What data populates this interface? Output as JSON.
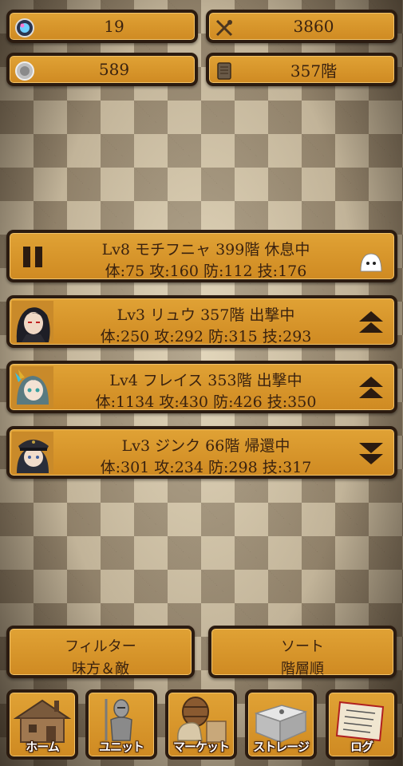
{
  "resources": {
    "gems": "19",
    "swords": "3860",
    "coins": "589",
    "floor": "357階"
  },
  "units": [
    {
      "line1": "Lv8 モチフニャ 399階 休息中",
      "line2": "体:75 攻:160 防:112 技:176",
      "left_icon": "pause-icon",
      "right_icon": "slime-icon"
    },
    {
      "line1": "Lv3 リュウ 357階 出撃中",
      "line2": "体:250 攻:292 防:315 技:293",
      "left_icon": "portrait-ryu",
      "right_icon": "double-up-arrow-icon"
    },
    {
      "line1": "Lv4 フレイス 353階 出撃中",
      "line2": "体:1134 攻:430 防:426 技:350",
      "left_icon": "portrait-freis",
      "right_icon": "double-up-arrow-icon"
    },
    {
      "line1": "Lv3 ジンク 66階 帰還中",
      "line2": "体:301 攻:234 防:298 技:317",
      "left_icon": "portrait-zinc",
      "right_icon": "double-down-arrow-icon"
    }
  ],
  "filter": {
    "title": "フィルター",
    "value": "味方＆敵"
  },
  "sort": {
    "title": "ソート",
    "value": "階層順"
  },
  "nav": [
    {
      "label": "ホーム",
      "icon": "house-icon"
    },
    {
      "label": "ユニット",
      "icon": "knight-icon"
    },
    {
      "label": "マーケット",
      "icon": "barrel-icon"
    },
    {
      "label": "ストレージ",
      "icon": "box-icon"
    },
    {
      "label": "ログ",
      "icon": "scroll-icon"
    }
  ],
  "colors": {
    "panel": "#d9952b",
    "border": "#2b1b10",
    "text": "#3a220f"
  }
}
